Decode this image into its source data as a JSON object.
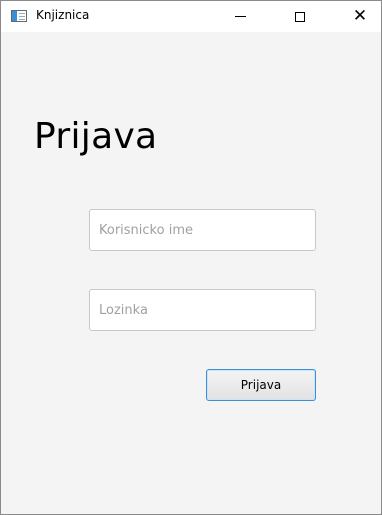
{
  "window": {
    "title": "Knjiznica",
    "icon": "app-window-icon",
    "controls": {
      "minimize_icon": "minimize-icon",
      "maximize_icon": "maximize-icon",
      "close_icon": "close-icon",
      "close_glyph": "✕"
    }
  },
  "login": {
    "heading": "Prijava",
    "username": {
      "value": "",
      "placeholder": "Korisnicko ime"
    },
    "password": {
      "value": "",
      "placeholder": "Lozinka"
    },
    "submit_label": "Prijava"
  },
  "colors": {
    "window_background": "#f4f4f4",
    "button_focus_border": "#3d8ed8"
  }
}
